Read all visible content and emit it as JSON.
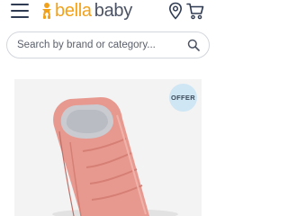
{
  "header": {
    "brand_first": "bella",
    "brand_second": "baby",
    "menu_icon": "hamburger-menu-icon",
    "location_icon": "location-pin-icon",
    "cart_icon": "shopping-cart-icon",
    "brand_color": "#f2a21a"
  },
  "search": {
    "placeholder": "Search by brand or category...",
    "icon": "search-icon"
  },
  "product": {
    "badge": "OFFER",
    "badge_color": "#cfe6f4",
    "image_subject": "pink quilted baby footmuff",
    "image_color": "#e8998f"
  }
}
